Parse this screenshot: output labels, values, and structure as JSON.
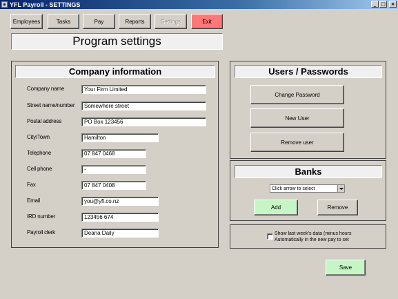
{
  "window": {
    "title": "YFL Payroll - SETTINGS",
    "controls": [
      "_",
      "□",
      "×"
    ]
  },
  "nav": {
    "employees": "Employees",
    "tasks": "Tasks",
    "pay": "Pay",
    "reports": "Reports",
    "settings": "Settings",
    "exit": "Exit"
  },
  "page_title": "Program settings",
  "company": {
    "heading": "Company information",
    "fields": [
      {
        "label": "Company name",
        "value": "Your Firm Limited"
      },
      {
        "label": "Street name/number",
        "value": "Somewhere street"
      },
      {
        "label": "Postal address",
        "value": "PO Box 123456"
      },
      {
        "label": "City/Town",
        "value": "Hamilton"
      },
      {
        "label": "Telephone",
        "value": "07 847 0468"
      },
      {
        "label": "Cell phone",
        "value": "-"
      },
      {
        "label": "Fax",
        "value": "07 847 0408"
      },
      {
        "label": "Email",
        "value": "you@yfl.co.nz"
      },
      {
        "label": "IRD number",
        "value": "123456 674"
      },
      {
        "label": "Payroll clerk",
        "value": "Deana Daily"
      }
    ]
  },
  "users": {
    "heading": "Users / Passwords",
    "change_password": "Change Password",
    "new_user": "New User",
    "remove_user": "Remove user"
  },
  "banks": {
    "heading": "Banks",
    "select_placeholder": "Click arrow to select",
    "add": "Add",
    "remove": "Remove"
  },
  "options": {
    "show_last_week_line1": "Show last week's data (minus hours",
    "show_last_week_line2": "Automatically in the new pay to set",
    "checked": false
  },
  "save_label": "Save",
  "colors": {
    "title_bar": "#0a246a",
    "window_bg": "#d4d0c8",
    "exit_button": "#ff7777",
    "accept_button": "#c6f5c6"
  }
}
